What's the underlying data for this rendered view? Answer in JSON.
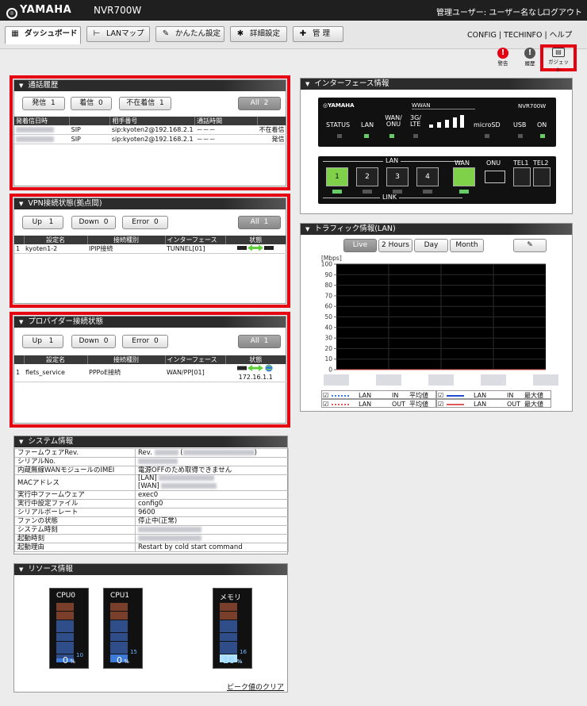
{
  "header": {
    "brand": "YAMAHA",
    "model": "NVR700W",
    "user": "管理ユーザー: ユーザー名なし",
    "logout": "ログアウト"
  },
  "tabs": [
    {
      "label": "ダッシュボード",
      "icon": "dashboard-icon"
    },
    {
      "label": "LANマップ",
      "icon": "lanmap-icon"
    },
    {
      "label": "かんたん設定",
      "icon": "wand-icon"
    },
    {
      "label": "詳細設定",
      "icon": "gear-icon"
    },
    {
      "label": "管 理",
      "icon": "wrench-icon"
    }
  ],
  "toplinks": [
    "CONFIG",
    "TECHINFO",
    "ヘルプ"
  ],
  "status_icons": [
    {
      "label": "警告",
      "color": "#e50012"
    },
    {
      "label": "履歴",
      "color": "#555555"
    },
    {
      "label": "ガジェット",
      "color": "#555555"
    }
  ],
  "call_history": {
    "title": "通話履歴",
    "buttons": {
      "out": "発信",
      "out_count": "1",
      "in": "着信",
      "in_count": "0",
      "missed": "不在着信",
      "missed_count": "1",
      "all": "All",
      "all_count": "2"
    },
    "columns": [
      "発着信日時",
      "",
      "相手番号",
      "通話時間",
      ""
    ],
    "rows": [
      {
        "type": "SIP",
        "number": "sip:kyoten2@192.168.2.1",
        "duration": "－－－",
        "status": "不在着信"
      },
      {
        "type": "SIP",
        "number": "sip:kyoten2@192.168.2.1",
        "duration": "－－－",
        "status": "発信"
      }
    ]
  },
  "vpn": {
    "title": "VPN接続状態(拠点間)",
    "buttons": {
      "up": "Up",
      "up_count": "1",
      "down": "Down",
      "down_count": "0",
      "error": "Error",
      "error_count": "0",
      "all": "All",
      "all_count": "1"
    },
    "columns": [
      "設定名",
      "接続種別",
      "インターフェース",
      "状態"
    ],
    "rows": [
      {
        "no": "1",
        "name": "kyoten1-2",
        "kind": "IPIP接続",
        "iface": "TUNNEL[01]"
      }
    ]
  },
  "provider": {
    "title": "プロバイダー接続状態",
    "buttons": {
      "up": "Up",
      "up_count": "1",
      "down": "Down",
      "down_count": "0",
      "error": "Error",
      "error_count": "0",
      "all": "All",
      "all_count": "1"
    },
    "columns": [
      "設定名",
      "接続種別",
      "インターフェース",
      "状態"
    ],
    "rows": [
      {
        "no": "1",
        "name": "flets_service",
        "kind": "PPPoE接続",
        "iface": "WAN/PP[01]",
        "ip": "172.16.1.1"
      }
    ]
  },
  "system": {
    "title": "システム情報",
    "rows": [
      {
        "k": "ファームウェアRev.",
        "v": "Rev."
      },
      {
        "k": "シリアルNo.",
        "v": ""
      },
      {
        "k": "内蔵無線WANモジュールのIMEI",
        "v": "電源OFFのため取得できません"
      },
      {
        "k": "MACアドレス",
        "v": "[LAN]",
        "v2": "[WAN]"
      },
      {
        "k": "実行中ファームウェア",
        "v": "exec0"
      },
      {
        "k": "実行中設定ファイル",
        "v": "config0"
      },
      {
        "k": "シリアルボーレート",
        "v": "9600"
      },
      {
        "k": "ファンの状態",
        "v": "停止中(正常)"
      },
      {
        "k": "システム時刻",
        "v": ""
      },
      {
        "k": "起動時刻",
        "v": ""
      },
      {
        "k": "起動理由",
        "v": "Restart by cold start command"
      }
    ]
  },
  "resource": {
    "title": "リソース情報",
    "meters": [
      {
        "label": "CPU0",
        "value": "0",
        "unit": "%",
        "peak": "10",
        "level": 0.0
      },
      {
        "label": "CPU1",
        "value": "0",
        "unit": "%",
        "peak": "15",
        "level": 0.0
      },
      {
        "label": "メモリ",
        "value": "16",
        "unit": "%",
        "peak": "16",
        "level": 0.16
      }
    ],
    "clear_link": "ピーク値のクリア"
  },
  "interface": {
    "title": "インターフェース情報",
    "device": {
      "brand": "YAMAHA",
      "wwan": "WWAN",
      "model": "NVR700W",
      "leds": [
        "STATUS",
        "LAN",
        "WAN/ ONU",
        "3G/ LTE",
        "microSD",
        "USB",
        "ON"
      ],
      "lan_label": "LAN",
      "link_label": "LINK",
      "lan_ports": [
        "1",
        "2",
        "3",
        "4"
      ],
      "wan": "WAN",
      "onu": "ONU",
      "tel1": "TEL1",
      "tel2": "TEL2"
    }
  },
  "traffic": {
    "title": "トラフィック情報(LAN)",
    "buttons": [
      "Live",
      "2 Hours",
      "Day",
      "Month"
    ],
    "unit": "[Mbps]",
    "legend": [
      {
        "label": "LAN",
        "dir": "IN",
        "stat": "平均値",
        "color": "#3a7de0",
        "style": "dotted"
      },
      {
        "label": "LAN",
        "dir": "IN",
        "stat": "最大値",
        "color": "#1f4fd0",
        "style": "solid"
      },
      {
        "label": "LAN",
        "dir": "OUT",
        "stat": "平均値",
        "color": "#e05a5a",
        "style": "dotted"
      },
      {
        "label": "LAN",
        "dir": "OUT",
        "stat": "最大値",
        "color": "#e05a5a",
        "style": "solid"
      }
    ],
    "chart_data": {
      "type": "line",
      "ylabel": "[Mbps]",
      "ylim": [
        0,
        100
      ],
      "yticks": [
        0,
        10,
        20,
        30,
        40,
        50,
        60,
        70,
        80,
        90,
        100
      ],
      "series": [
        {
          "name": "LAN IN 平均値",
          "values": [
            0,
            0,
            0,
            0,
            0,
            0
          ]
        },
        {
          "name": "LAN IN 最大値",
          "values": [
            0,
            0,
            0,
            0,
            0,
            0
          ]
        },
        {
          "name": "LAN OUT 平均値",
          "values": [
            0,
            0,
            0,
            0,
            0,
            0
          ]
        },
        {
          "name": "LAN OUT 最大値",
          "values": [
            0,
            0,
            0,
            0,
            0,
            0
          ]
        }
      ]
    }
  }
}
